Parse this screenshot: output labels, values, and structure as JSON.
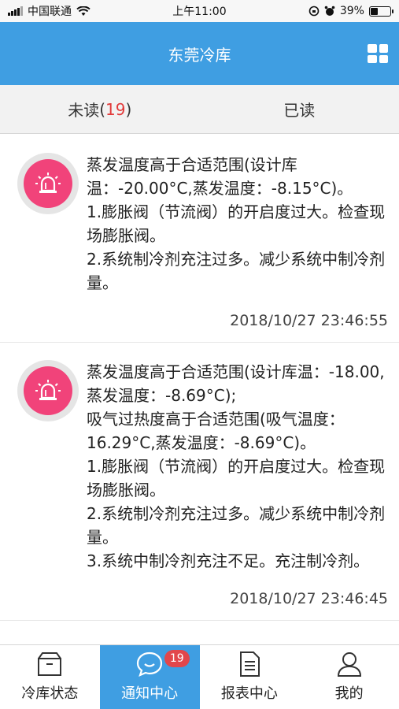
{
  "status_bar": {
    "carrier": "中国联通",
    "time": "上午11:00",
    "battery_percent": "39%",
    "battery_level": 0.39
  },
  "header": {
    "title": "东莞冷库",
    "menu_icon": "grid-icon"
  },
  "tabs": [
    {
      "label": "未读",
      "count": "19",
      "active": true
    },
    {
      "label": "已读",
      "active": false
    }
  ],
  "notices": [
    {
      "icon": "alarm-light-icon",
      "text": "蒸发温度高于合适范围(设计库温：-20.00°C,蒸发温度：-8.15°C)。\n1.膨胀阀（节流阀）的开启度过大。检查现场膨胀阀。\n2.系统制冷剂充注过多。减少系统中制冷剂量。",
      "time": "2018/10/27 23:46:55"
    },
    {
      "icon": "alarm-light-icon",
      "text": "蒸发温度高于合适范围(设计库温：-18.00,蒸发温度：-8.69°C);\n吸气过热度高于合适范围(吸气温度：16.29°C,蒸发温度：-8.69°C)。\n1.膨胀阀（节流阀）的开启度过大。检查现场膨胀阀。\n2.系统制冷剂充注过多。减少系统中制冷剂量。\n3.系统中制冷剂充注不足。充注制冷剂。",
      "time": "2018/10/27 23:46:45"
    }
  ],
  "bottom_nav": [
    {
      "label": "冷库状态",
      "icon": "box-icon",
      "active": false
    },
    {
      "label": "通知中心",
      "icon": "chat-bubble-icon",
      "active": true,
      "badge": "19"
    },
    {
      "label": "报表中心",
      "icon": "document-icon",
      "active": false
    },
    {
      "label": "我的",
      "icon": "person-icon",
      "active": false
    }
  ],
  "colors": {
    "primary": "#3f9ee2",
    "alarm": "#f1437a",
    "badge": "#e2464b",
    "count": "#e23a3a"
  }
}
